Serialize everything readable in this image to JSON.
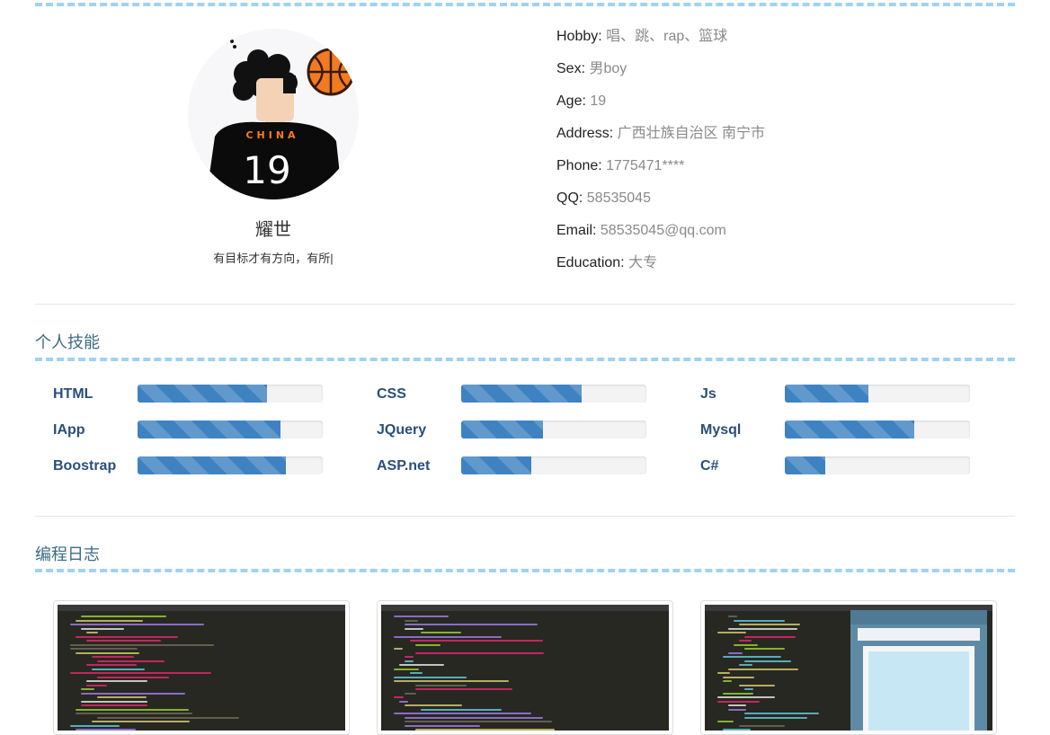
{
  "profile": {
    "name": "耀世",
    "motto": "有目标才有方向，有所|",
    "avatar_icon": "cartoon-basketball-player-avatar",
    "avatar_shirt_text": "CHINA",
    "avatar_shirt_number": "19"
  },
  "info": [
    {
      "key": "Hobby",
      "value": "唱、跳、rap、篮球"
    },
    {
      "key": "Sex",
      "value": "男boy"
    },
    {
      "key": "Age",
      "value": "19"
    },
    {
      "key": "Address",
      "value": "广西壮族自治区 南宁市"
    },
    {
      "key": "Phone",
      "value": "1775471****"
    },
    {
      "key": "QQ",
      "value": "58535045"
    },
    {
      "key": "Email",
      "value": "58535045@qq.com"
    },
    {
      "key": "Education",
      "value": "大专"
    }
  ],
  "skills_section": {
    "title": "个人技能",
    "skills": [
      {
        "name": "HTML",
        "level": 0.7
      },
      {
        "name": "CSS",
        "level": 0.65
      },
      {
        "name": "Js",
        "level": 0.45
      },
      {
        "name": "IApp",
        "level": 0.77
      },
      {
        "name": "JQuery",
        "level": 0.44
      },
      {
        "name": "Mysql",
        "level": 0.7
      },
      {
        "name": "Boostrap",
        "level": 0.8
      },
      {
        "name": "ASP.net",
        "level": 0.38
      },
      {
        "name": "C#",
        "level": 0.22
      }
    ]
  },
  "blog_section": {
    "title": "编程日志",
    "posts": [
      {
        "thumbnail": "code-editor-screenshot"
      },
      {
        "thumbnail": "code-editor-screenshot"
      },
      {
        "thumbnail": "code-editor-and-browser-preview-screenshot"
      }
    ]
  },
  "colors": {
    "accent": "#3e82c1",
    "skill_name": "#2a4f7b",
    "section_title": "#3d6b85",
    "dash": "#9fd3f2"
  }
}
